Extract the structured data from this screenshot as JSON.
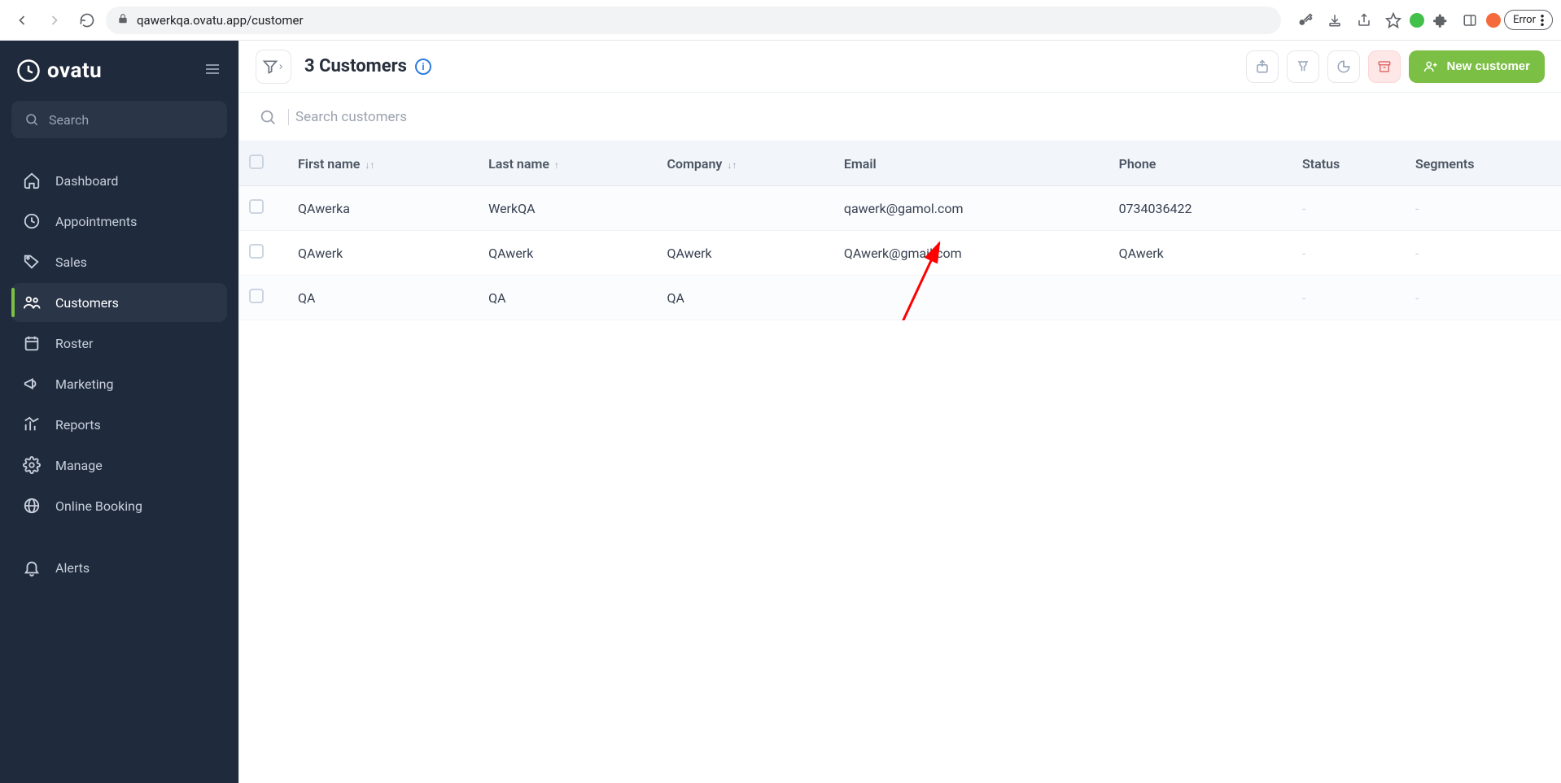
{
  "browser": {
    "url": "qawerkqa.ovatu.app/customer",
    "error_label": "Error"
  },
  "brand": "ovatu",
  "sidebar": {
    "search_label": "Search",
    "items": [
      {
        "label": "Dashboard"
      },
      {
        "label": "Appointments"
      },
      {
        "label": "Sales"
      },
      {
        "label": "Customers"
      },
      {
        "label": "Roster"
      },
      {
        "label": "Marketing"
      },
      {
        "label": "Reports"
      },
      {
        "label": "Manage"
      },
      {
        "label": "Online Booking"
      }
    ],
    "alerts_label": "Alerts"
  },
  "header": {
    "title": "3 Customers",
    "new_customer_label": "New customer"
  },
  "search": {
    "placeholder": "Search customers"
  },
  "table": {
    "columns": {
      "first_name": "First name",
      "last_name": "Last name",
      "company": "Company",
      "email": "Email",
      "phone": "Phone",
      "status": "Status",
      "segments": "Segments"
    },
    "rows": [
      {
        "first_name": "QAwerka",
        "last_name": "WerkQA",
        "company": "",
        "email": "qawerk@gamol.com",
        "phone": "0734036422",
        "status": "-",
        "segments": "-"
      },
      {
        "first_name": "QAwerk",
        "last_name": "QAwerk",
        "company": "QAwerk",
        "email": "QAwerk@gmail.com",
        "phone": "QAwerk",
        "status": "-",
        "segments": "-"
      },
      {
        "first_name": "QA",
        "last_name": "QA",
        "company": "QA",
        "email": "",
        "phone": "",
        "status": "-",
        "segments": "-"
      }
    ]
  }
}
